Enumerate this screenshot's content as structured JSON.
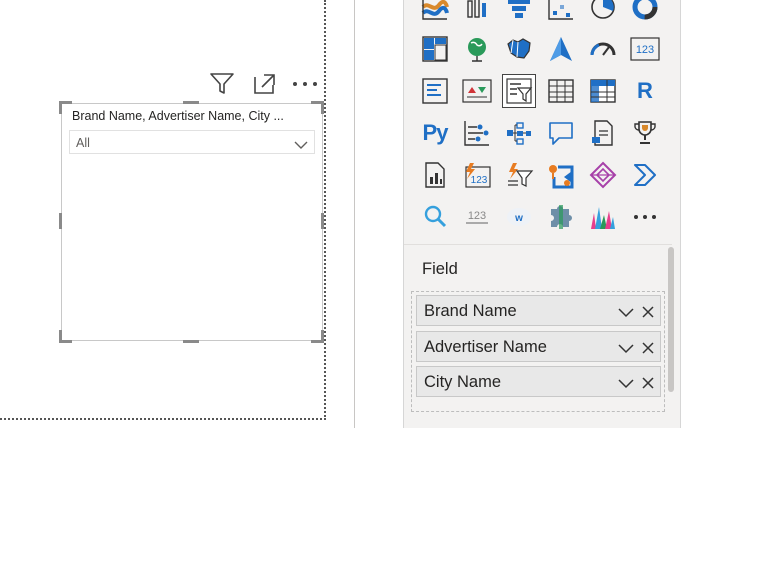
{
  "slicer": {
    "title": "Brand Name, Advertiser Name, City ...",
    "selected_value": "All"
  },
  "visual_header": {
    "filter_icon": "filter-icon",
    "focus_icon": "focus-mode-icon",
    "more_icon": "more-options-icon"
  },
  "pane": {
    "gallery_icons": [
      "ribbon-chart-icon",
      "waterfall-chart-icon",
      "funnel-icon",
      "scatter-chart-icon",
      "pie-chart-icon",
      "donut-chart-icon",
      "treemap-icon",
      "map-icon",
      "filled-map-icon",
      "azure-map-icon",
      "gauge-icon",
      "card-icon",
      "multi-row-card-icon",
      "kpi-icon",
      "slicer-icon",
      "table-icon",
      "matrix-icon",
      "r-visual-icon",
      "python-visual-icon",
      "key-influencers-icon",
      "decomposition-tree-icon",
      "qa-icon",
      "paginated-report-icon",
      "goals-icon",
      "power-apps-icon",
      "power-automate-icon",
      "filter-visual-icon",
      "power-bi-icon",
      "flow-icon",
      "arrow-icon",
      "search-visual-icon",
      "number-card-icon",
      "word-cloud-icon",
      "puzzle-icon",
      "histogram-icon",
      "more-visuals-icon"
    ],
    "r_label": "R",
    "py_label": "Py",
    "card_label": "123",
    "field_label": "Field",
    "fields": [
      {
        "label": "Brand Name"
      },
      {
        "label": "Advertiser Name"
      },
      {
        "label": "City Name"
      }
    ]
  },
  "colors": {
    "accent": "#1f6fc5",
    "pane_bg": "#f3f2f1",
    "pill_bg": "#e8e8e8"
  }
}
